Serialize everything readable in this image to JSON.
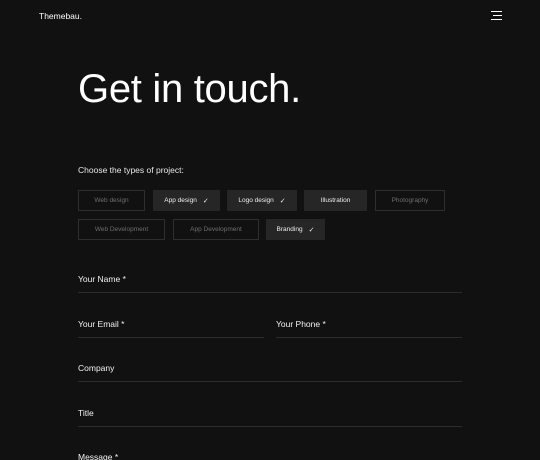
{
  "header": {
    "logo": "Themebau.",
    "menu_icon": "hamburger-menu-icon"
  },
  "hero": {
    "title": "Get in touch."
  },
  "project_types": {
    "label": "Choose the types of project:",
    "check_icon": "checkmark-icon",
    "options": [
      {
        "label": "Web design",
        "selected": false
      },
      {
        "label": "App design",
        "selected": true
      },
      {
        "label": "Logo design",
        "selected": true
      },
      {
        "label": "Illustration",
        "selected": true
      },
      {
        "label": "Photography",
        "selected": false
      },
      {
        "label": "Web Development",
        "selected": false
      },
      {
        "label": "App Development",
        "selected": false
      },
      {
        "label": "Branding",
        "selected": true
      }
    ]
  },
  "form": {
    "name_label": "Your Name *",
    "email_label": "Your Email *",
    "phone_label": "Your Phone *",
    "company_label": "Company",
    "title_label": "Title",
    "message_label": "Message *"
  },
  "colors": {
    "background": "#111111",
    "text": "#ffffff",
    "chip_selected_bg": "#262626",
    "chip_border": "#2e2e2e",
    "field_line": "#2c2c2c"
  }
}
